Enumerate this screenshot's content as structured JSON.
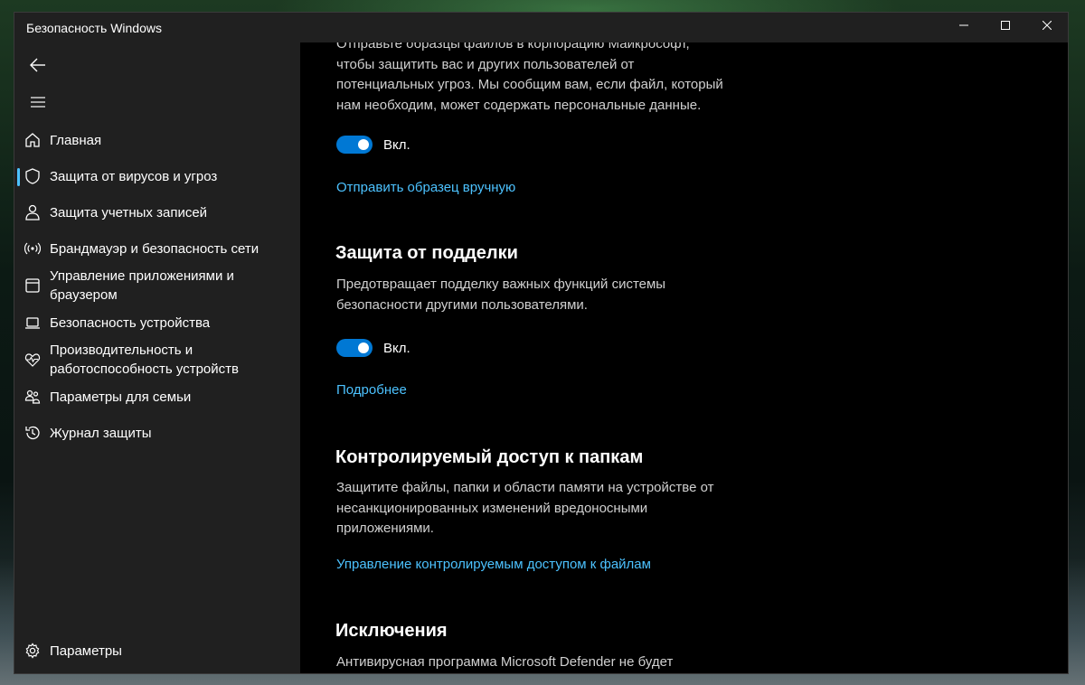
{
  "window": {
    "title": "Безопасность Windows",
    "controls": [
      "minimize",
      "maximize",
      "close"
    ]
  },
  "sidebar": {
    "back_icon": "arrow-left-icon",
    "menu_icon": "hamburger-icon",
    "items": [
      {
        "label": "Главная",
        "icon": "home-icon"
      },
      {
        "label": "Защита от вирусов и угроз",
        "icon": "shield-icon",
        "selected": true
      },
      {
        "label": "Защита учетных записей",
        "icon": "person-icon"
      },
      {
        "label": "Брандмауэр и безопасность сети",
        "icon": "antenna-icon"
      },
      {
        "label": "Управление приложениями и браузером",
        "icon": "app-window-icon"
      },
      {
        "label": "Безопасность устройства",
        "icon": "laptop-icon"
      },
      {
        "label": "Производительность и работоспособность устройств",
        "icon": "heart-pulse-icon"
      },
      {
        "label": "Параметры для семьи",
        "icon": "family-icon"
      },
      {
        "label": "Журнал защиты",
        "icon": "history-icon"
      }
    ],
    "settings": {
      "label": "Параметры",
      "icon": "gear-icon"
    }
  },
  "content": {
    "sample_submission": {
      "description_lines": [
        "Отправьте образцы файлов в корпорацию Майкрософт,",
        "чтобы защитить вас и других пользователей от",
        "потенциальных угроз. Мы сообщим вам, если файл, который",
        "нам необходим, может содержать персональные данные."
      ],
      "toggle_state": "Вкл.",
      "toggle_on": true,
      "link": "Отправить образец вручную"
    },
    "tamper_protection": {
      "title": "Защита от подделки",
      "description_lines": [
        "Предотвращает подделку важных функций системы",
        "безопасности другими пользователями."
      ],
      "toggle_state": "Вкл.",
      "toggle_on": true,
      "link": "Подробнее"
    },
    "controlled_folder_access": {
      "title": "Контролируемый доступ к папкам",
      "description_lines": [
        "Защитите файлы, папки и области памяти на устройстве от",
        "несанкционированных изменений вредоносными",
        "приложениями."
      ],
      "link": "Управление контролируемым доступом к файлам"
    },
    "exclusions": {
      "title": "Исключения",
      "description_lines": [
        "Антивирусная программа Microsoft Defender не будет"
      ]
    }
  },
  "colors": {
    "accent_link": "#4cc2ff",
    "toggle_on": "#0078d4",
    "sidebar_bg": "#202020",
    "content_bg": "#000000"
  }
}
